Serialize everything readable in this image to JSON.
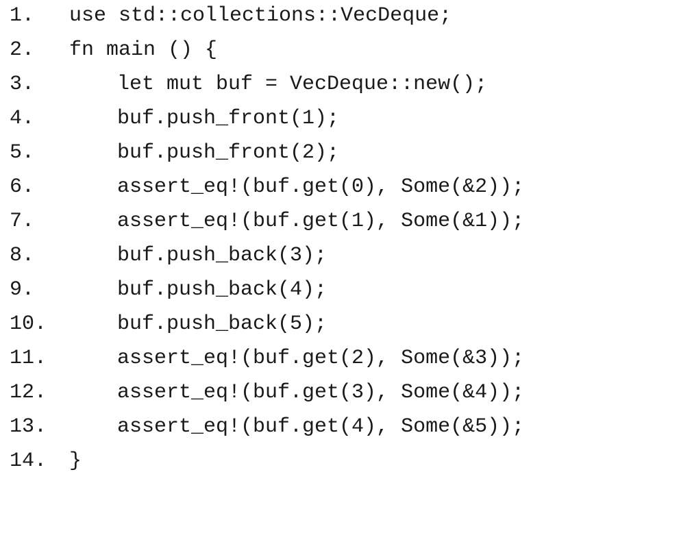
{
  "code": {
    "lines": [
      {
        "number": "1.",
        "text": "use std::collections::VecDeque;",
        "indent": 0
      },
      {
        "number": "2.",
        "text": "fn main () {",
        "indent": 0
      },
      {
        "number": "3.",
        "text": "let mut buf = VecDeque::new();",
        "indent": 1
      },
      {
        "number": "4.",
        "text": "buf.push_front(1);",
        "indent": 1
      },
      {
        "number": "5.",
        "text": "buf.push_front(2);",
        "indent": 1
      },
      {
        "number": "6.",
        "text": "assert_eq!(buf.get(0), Some(&2));",
        "indent": 1
      },
      {
        "number": "7.",
        "text": "assert_eq!(buf.get(1), Some(&1));",
        "indent": 1
      },
      {
        "number": "8.",
        "text": "buf.push_back(3);",
        "indent": 1
      },
      {
        "number": "9.",
        "text": "buf.push_back(4);",
        "indent": 1
      },
      {
        "number": "10.",
        "text": "buf.push_back(5);",
        "indent": 1
      },
      {
        "number": "11.",
        "text": "assert_eq!(buf.get(2), Some(&3));",
        "indent": 1
      },
      {
        "number": "12.",
        "text": "assert_eq!(buf.get(3), Some(&4));",
        "indent": 1
      },
      {
        "number": "13.",
        "text": "assert_eq!(buf.get(4), Some(&5));",
        "indent": 1
      },
      {
        "number": "14.",
        "text": "}",
        "indent": 0
      }
    ]
  }
}
